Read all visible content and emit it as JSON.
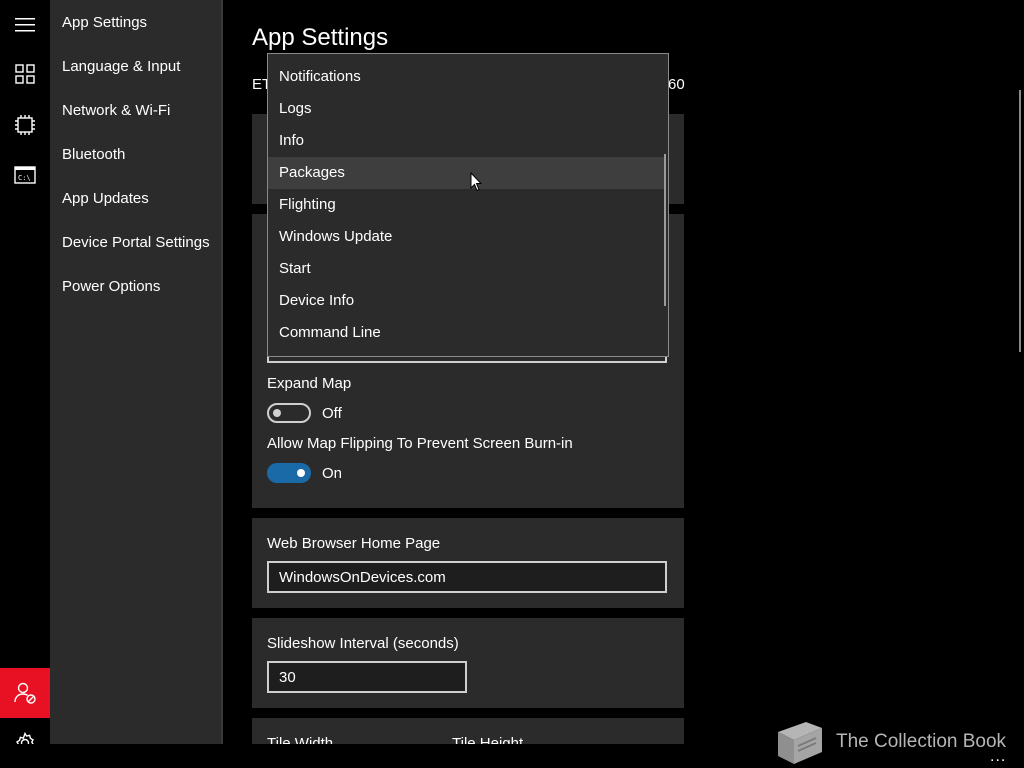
{
  "sidebar": {
    "items": [
      {
        "label": "App Settings"
      },
      {
        "label": "Language & Input"
      },
      {
        "label": "Network & Wi-Fi"
      },
      {
        "label": "Bluetooth"
      },
      {
        "label": "App Updates"
      },
      {
        "label": "Device Portal Settings"
      },
      {
        "label": "Power Options"
      }
    ]
  },
  "rail": {
    "icons": [
      "hamburger-icon",
      "dashboard-icon",
      "chip-icon",
      "command-prompt-icon",
      "user-signout-icon",
      "gear-icon"
    ],
    "user_button_color": "#e81123"
  },
  "main": {
    "title": "App Settings",
    "partial_left_text": "ET",
    "partial_right_text": "60",
    "dropdown": {
      "items": [
        "Notifications",
        "Logs",
        "Info",
        "Packages",
        "Flighting",
        "Windows Update",
        "Start",
        "Device Info",
        "Command Line"
      ],
      "hovered": "Packages"
    },
    "expand_map": {
      "label": "Expand Map",
      "state": "Off"
    },
    "map_flipping": {
      "label": "Allow Map Flipping To Prevent Screen Burn-in",
      "state": "On"
    },
    "web_browser": {
      "label": "Web Browser Home Page",
      "value": "WindowsOnDevices.com"
    },
    "slideshow": {
      "label": "Slideshow Interval (seconds)",
      "value": "30"
    },
    "tile_width_label": "Tile Width",
    "tile_height_label": "Tile Height",
    "accent_color": "#1b6aa8"
  },
  "watermark": {
    "text": "The Collection Book"
  },
  "more_label": "..."
}
